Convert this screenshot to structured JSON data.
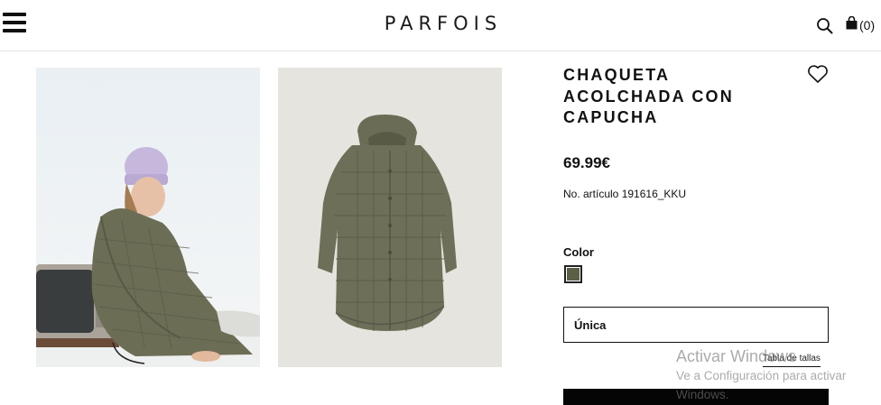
{
  "header": {
    "logo_text": "PARFOIS",
    "cart_count": "(0)",
    "icons": {
      "menu": "hamburger-menu-icon",
      "search": "search-icon",
      "cart": "shopping-bag-icon"
    }
  },
  "gallery": {
    "images": [
      {
        "alt": "model-wearing-jacket-photo"
      },
      {
        "alt": "jacket-product-photo"
      }
    ]
  },
  "product": {
    "title": "CHAQUETA ACOLCHADA CON CAPUCHA",
    "price": "69.99€",
    "sku_text": "No. artículo 191616_KKU",
    "color_label": "Color",
    "selected_color": "#5b5f45",
    "size_value": "Única",
    "size_guide_label": "Tabla de tallas",
    "wishlist_icon": "heart-icon"
  },
  "os_watermark": {
    "title": "Activar Windows",
    "line1": "Ve a Configuración para activar",
    "line2": "Windows."
  }
}
